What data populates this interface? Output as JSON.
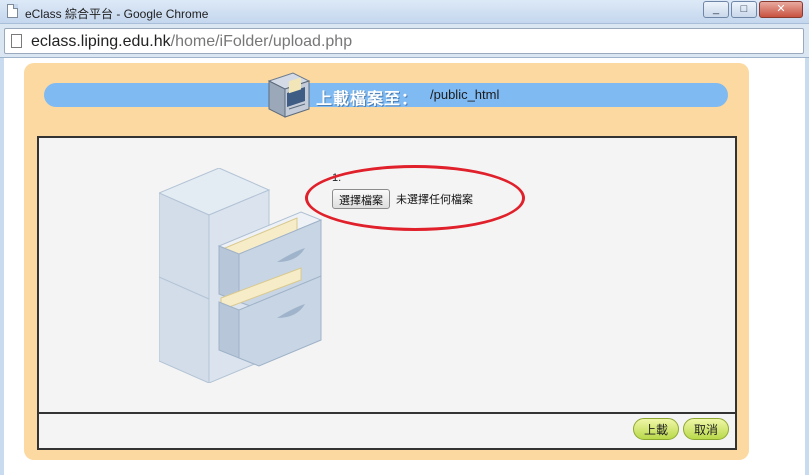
{
  "window": {
    "title": "eClass 綜合平台 - Google Chrome",
    "minimize": "_",
    "maximize": "□",
    "close": "✕"
  },
  "address": {
    "host": "eclass.liping.edu.hk",
    "path": "/home/iFolder/upload.php"
  },
  "upload": {
    "header_label": "上載檔案至：",
    "folder_path": "/public_html",
    "row_number": "1.",
    "choose_file_label": "選擇檔案",
    "no_file_text": "未選擇任何檔案",
    "submit_label": "上載",
    "cancel_label": "取消"
  },
  "colors": {
    "panel": "#fbd9a0",
    "header_bar": "#7fbaf2",
    "highlight": "#e0202a",
    "pill_button": "#b9d94a"
  }
}
